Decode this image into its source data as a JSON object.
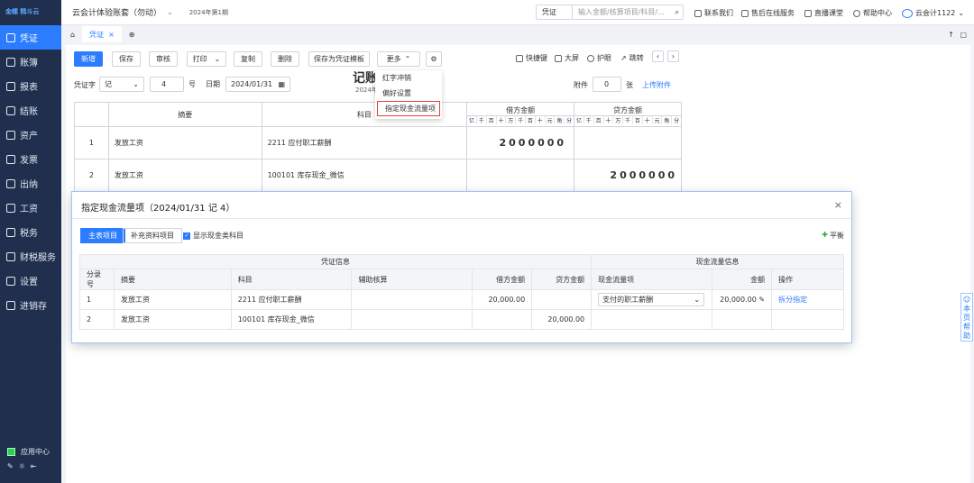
{
  "sidebar": {
    "logo": "金蝶 精斗云",
    "items": [
      "凭证",
      "账簿",
      "报表",
      "结账",
      "资产",
      "发票",
      "出纳",
      "工资",
      "税务",
      "财税服务",
      "设置",
      "进销存"
    ],
    "bottom": "应用中心"
  },
  "topbar": {
    "account": "云会计体验账套（勿动）",
    "period": "2024年第1期",
    "search_type": "凭证",
    "search_placeholder": "输入金额/核算项目/科目/...",
    "links": [
      "联系我们",
      "售后在线服务",
      "直播课堂",
      "帮助中心"
    ],
    "user": "云会计1122"
  },
  "tabs": {
    "tab": "凭证"
  },
  "toolbar": {
    "buttons": [
      "新增",
      "保存",
      "审核",
      "打印",
      "复制",
      "删除",
      "保存为凭证模板",
      "更多"
    ],
    "right": [
      "快捷键",
      "大屏",
      "护眼",
      "跳转"
    ]
  },
  "dropdown": [
    "红字冲销",
    "偏好设置",
    "指定现金流量项"
  ],
  "voucher": {
    "word_label": "凭证字",
    "word": "记",
    "num": "4",
    "num_label": "号",
    "date_label": "日期",
    "date": "2024/01/31",
    "title": "记账",
    "subtitle": "2024年",
    "attach_label": "附件",
    "attach": "0",
    "attach_unit": "张",
    "upload": "上传附件",
    "headers": {
      "summary": "摘要",
      "subject": "科目",
      "debit": "借方金额",
      "credit": "贷方金额",
      "digits": [
        "亿",
        "千",
        "百",
        "十",
        "万",
        "千",
        "百",
        "十",
        "元",
        "角",
        "分"
      ]
    },
    "rows": [
      {
        "no": "1",
        "summary": "发放工资",
        "subject": "2211 应付职工薪酬",
        "debit": "2000000",
        "credit": ""
      },
      {
        "no": "2",
        "summary": "发放工资",
        "subject": "100101 库存现金_微信",
        "debit": "",
        "credit": "2000000"
      }
    ]
  },
  "modal": {
    "title": "指定现金流量项（2024/01/31 记 4）",
    "tabs": [
      "主表项目",
      "补充资料项目"
    ],
    "checkbox": "显示现金类科目",
    "balance": "平衡",
    "group1": "凭证信息",
    "group2": "现金流量信息",
    "cols": [
      "分录号",
      "摘要",
      "科目",
      "辅助核算",
      "借方金额",
      "贷方金额",
      "现金流量项",
      "金额",
      "操作"
    ],
    "rows": [
      {
        "no": "1",
        "summary": "发放工资",
        "subject": "2211 应付职工薪酬",
        "aux": "",
        "debit": "20,000.00",
        "credit": "",
        "flow": "支付的职工薪酬",
        "amount": "20,000.00",
        "op": "拆分指定"
      },
      {
        "no": "2",
        "summary": "发放工资",
        "subject": "100101 库存现金_微信",
        "aux": "",
        "debit": "",
        "credit": "20,000.00",
        "flow": "",
        "amount": "",
        "op": ""
      }
    ]
  },
  "help": "本页帮助"
}
